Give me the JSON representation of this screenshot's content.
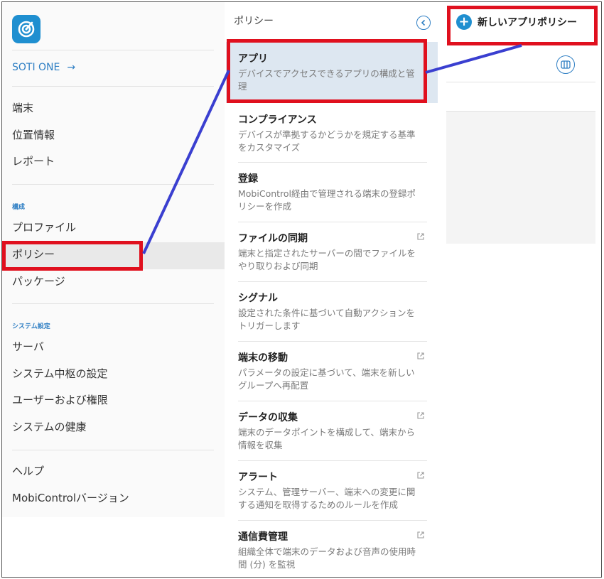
{
  "sidebar": {
    "product_link": "SOTI ONE",
    "product_arrow": "→",
    "items_top": [
      "端末",
      "位置情報",
      "レポート"
    ],
    "section_config": "構成",
    "items_config": [
      "プロファイル",
      "ポリシー",
      "パッケージ"
    ],
    "section_system": "システム設定",
    "items_system": [
      "サーバ",
      "システム中枢の設定",
      "ユーザーおよび権限",
      "システムの健康"
    ],
    "items_bottom": [
      "ヘルプ",
      "MobiControlバージョン"
    ]
  },
  "policy_panel": {
    "title": "ポリシー",
    "items": [
      {
        "title": "アプリ",
        "desc1": "デバイスでアクセスできるアプリの構成と管",
        "desc2": "理"
      },
      {
        "title": "コンプライアンス",
        "desc1": "デバイスが準拠するかどうかを規定する基準",
        "desc2": "をカスタマイズ"
      },
      {
        "title": "登録",
        "desc1": "MobiControl経由で管理される端末の登録ポ",
        "desc2": "リシーを作成"
      },
      {
        "title": "ファイルの同期",
        "desc1": "端末と指定されたサーバーの間でファイルを",
        "desc2": "やり取りおよび同期"
      },
      {
        "title": "シグナル",
        "desc1": "設定された条件に基づいて自動アクションを",
        "desc2": "トリガーします"
      },
      {
        "title": "端末の移動",
        "desc1": "パラメータの設定に基づいて、端末を新しい",
        "desc2": "グループへ再配置"
      },
      {
        "title": "データの収集",
        "desc1": "端末のデータポイントを構成して、端末から",
        "desc2": "情報を収集"
      },
      {
        "title": "アラート",
        "desc1": "システム、管理サーバー、端末への変更に関",
        "desc2": "する通知を取得するためのルールを作成"
      },
      {
        "title": "通信費管理",
        "desc1": "組織全体で端末のデータおよび音声の使用時",
        "desc2": "間 (分) を監視"
      }
    ]
  },
  "toolbar": {
    "new_policy_label": "新しいアプリポリシー"
  },
  "colors": {
    "accent": "#1f8fd0",
    "link": "#2f7fc4",
    "highlight_box": "#e0101e",
    "connector": "#3a3fd0",
    "selected_row": "#dde7f1"
  },
  "icons": [
    "app-logo-icon",
    "arrow-right-icon",
    "chevron-left-circle-icon",
    "plus-circle-icon",
    "columns-icon",
    "external-link-icon"
  ]
}
